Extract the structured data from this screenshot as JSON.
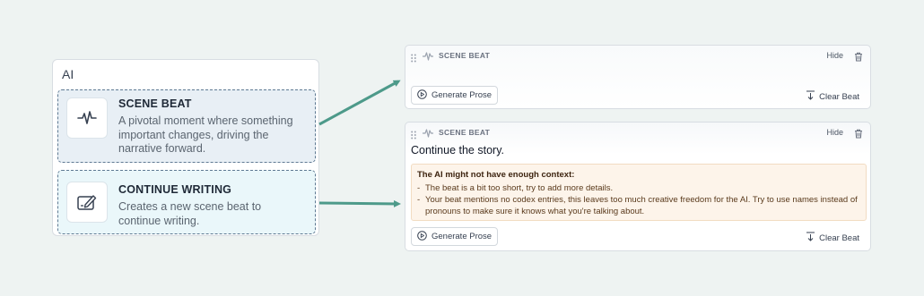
{
  "ai_menu": {
    "title": "AI",
    "items": [
      {
        "title": "SCENE BEAT",
        "description": "A pivotal moment where something important changes, driving the narrative forward.",
        "icon": "pulse-icon"
      },
      {
        "title": "CONTINUE WRITING",
        "description": "Creates a new scene beat to continue writing.",
        "icon": "pen-edit-icon"
      }
    ]
  },
  "cards": [
    {
      "label": "SCENE BEAT",
      "hide_label": "Hide",
      "generate_label": "Generate Prose",
      "clear_label": "Clear Beat"
    },
    {
      "label": "SCENE BEAT",
      "hide_label": "Hide",
      "text": "Continue the story.",
      "warning": {
        "title": "The AI might not have enough context:",
        "items": [
          "The beat is a bit too short, try to add more details.",
          "Your beat mentions no codex entries, this leaves too much creative freedom for the AI. Try to use names instead of pronouns to make sure it knows what you're talking about."
        ]
      },
      "generate_label": "Generate Prose",
      "clear_label": "Clear Beat"
    }
  ],
  "colors": {
    "arrow": "#4d9a8a",
    "background": "#eef3f2",
    "warning_bg": "#fdf4ea"
  }
}
